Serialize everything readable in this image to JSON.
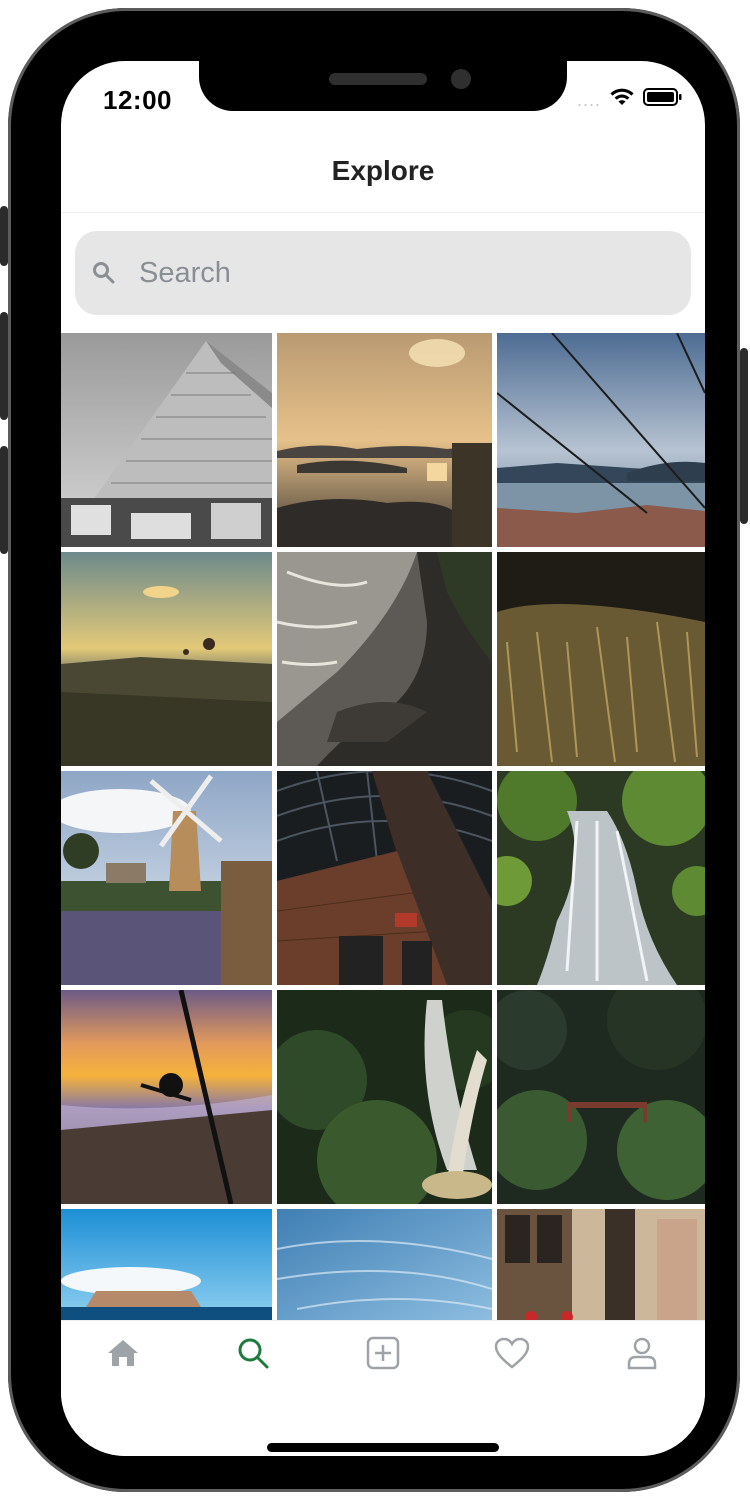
{
  "status_bar": {
    "time": "12:00",
    "signal": "....",
    "icons": [
      "wifi-icon",
      "battery-icon"
    ]
  },
  "header": {
    "title": "Explore"
  },
  "search": {
    "placeholder": "Search",
    "value": "",
    "icon": "search-icon"
  },
  "grid": {
    "columns": 3,
    "photos": [
      "pyramid",
      "sunset-islands",
      "cable-car-harbor",
      "hot-air-balloons",
      "sea-coast",
      "wheat-field",
      "windmill",
      "glass-dome-building",
      "waterfall-forest",
      "fishing-rod-sunset",
      "forest-waterfall",
      "forest-bridge",
      "sea-rock",
      "blue-sky",
      "old-town-street"
    ]
  },
  "tab_bar": {
    "tabs": [
      {
        "icon": "home-icon",
        "active": false
      },
      {
        "icon": "search-icon",
        "active": true
      },
      {
        "icon": "add-icon",
        "active": false
      },
      {
        "icon": "heart-icon",
        "active": false
      },
      {
        "icon": "profile-icon",
        "active": false
      }
    ],
    "active_color": "#1e7a3c",
    "inactive_color": "#9ea3a8"
  }
}
